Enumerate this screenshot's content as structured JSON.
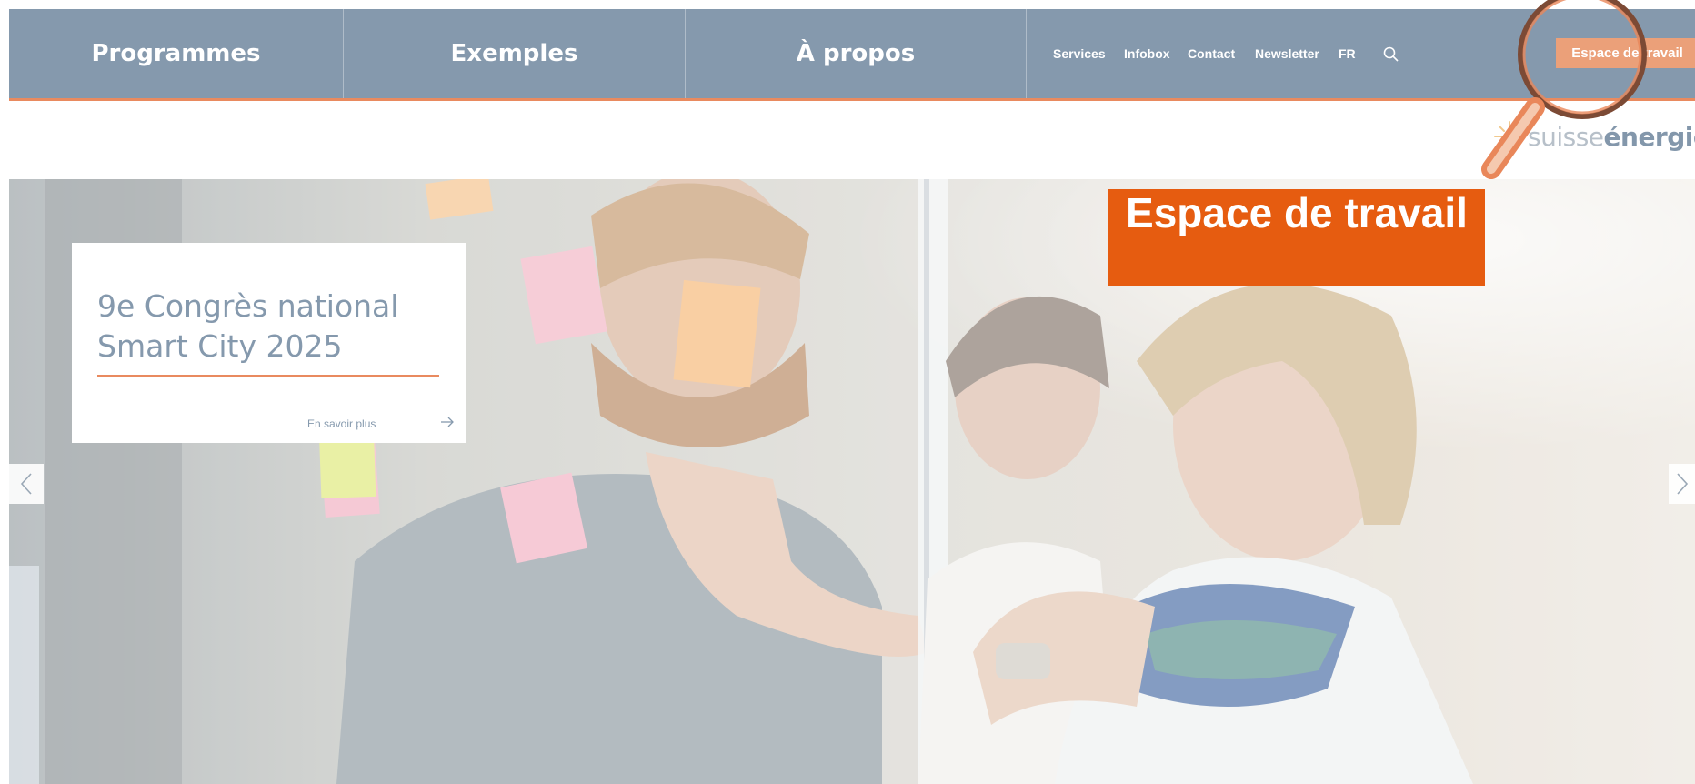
{
  "nav": {
    "main_items": [
      {
        "label": "Programmes"
      },
      {
        "label": "Exemples"
      },
      {
        "label": "À propos"
      }
    ],
    "utility_items": [
      {
        "label": "Services"
      },
      {
        "label": "Infobox"
      },
      {
        "label": "Contact"
      },
      {
        "label": "Newsletter"
      },
      {
        "label": "FR"
      }
    ],
    "search_icon": "search-icon",
    "workspace_button": "Espace de travail"
  },
  "logo": {
    "part1": "suisse",
    "part2": "énergie"
  },
  "hero": {
    "card": {
      "title": "9e Congrès national Smart City 2025",
      "link": "En savoir plus"
    },
    "prev_icon": "chevron-left-icon",
    "next_icon": "chevron-right-icon"
  },
  "callout": {
    "text": "Espace de travail"
  },
  "colors": {
    "nav_bg": "#8599ad",
    "accent": "#e98a5f",
    "button_bg": "#eba079",
    "callout_bg": "#e65c10",
    "magnifier": "#e9875a"
  }
}
